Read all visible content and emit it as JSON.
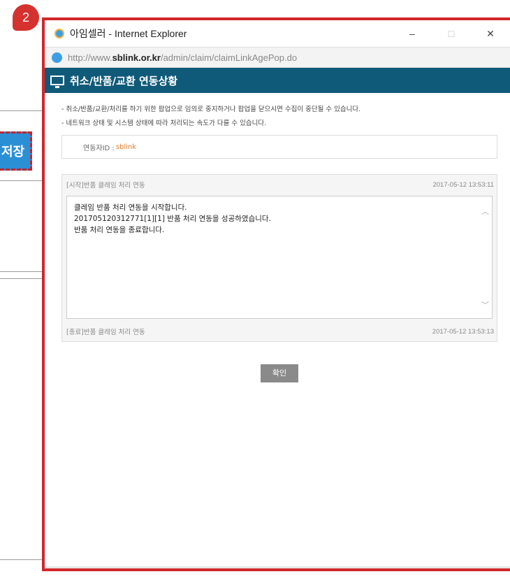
{
  "step_badge": "2",
  "background": {
    "save_button_label": "저장"
  },
  "window": {
    "title": "아임셀러 - Internet Explorer",
    "controls": {
      "minimize": "–",
      "maximize": "□",
      "close": "✕"
    },
    "address": {
      "prefix": "http://www.",
      "domain": "sblink.or.kr",
      "path": "/admin/claim/claimLinkAgePop.do"
    }
  },
  "popup": {
    "title": "취소/반품/교환 연동상황",
    "notices": [
      "- 취소/반품/교환/처리를 하기 위한 팝업으로 임의로 중지하거나 팝업을 닫으시면 수집이 중단될 수 있습니다.",
      "- 네트워크 상태 및 시스템 상태에 따라 처리되는 속도가 다를 수 있습니다."
    ],
    "user_label": "연동자ID :",
    "user_id": "sblink",
    "log_start": {
      "label": "[시작]반품 클레임 처리 연동",
      "timestamp": "2017-05-12 13:53:11"
    },
    "log_lines": [
      "클레임 반품 처리 연동을 시작합니다.",
      "20170512031277​1[1][1] 반품 처리 연동을 성공하였습니다.",
      "반품 처리 연동을 종료합니다."
    ],
    "log_end": {
      "label": "[종료]반품 클레임 처리 연동",
      "timestamp": "2017-05-12 13:53:13"
    },
    "confirm_label": "확인"
  }
}
